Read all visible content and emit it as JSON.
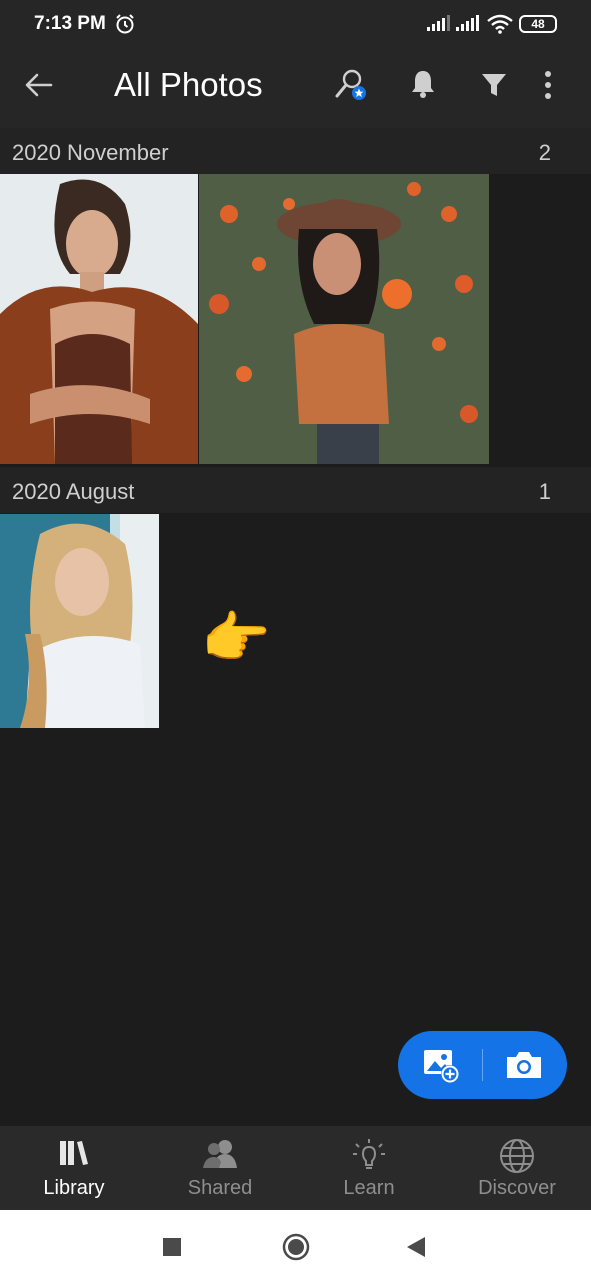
{
  "status_bar": {
    "time": "7:13 PM",
    "battery": "48"
  },
  "app_bar": {
    "title": "All Photos",
    "icons": [
      "back-arrow-icon",
      "people-search-icon",
      "bell-icon",
      "filter-icon",
      "more-vertical-icon"
    ]
  },
  "sections": [
    {
      "label": "2020 November",
      "count": "2",
      "photos": [
        "portrait-woman-rust-jacket",
        "portrait-woman-hat-flowers"
      ]
    },
    {
      "label": "2020 August",
      "count": "1",
      "photos": [
        "portrait-woman-white-shirt"
      ]
    }
  ],
  "annotation": {
    "emoji": "👉"
  },
  "fab": {
    "icons": [
      "add-photo-icon",
      "camera-icon"
    ],
    "color": "#1473e6"
  },
  "bottom_nav": {
    "items": [
      {
        "label": "Library",
        "icon": "library-icon",
        "active": true
      },
      {
        "label": "Shared",
        "icon": "shared-people-icon",
        "active": false
      },
      {
        "label": "Learn",
        "icon": "lightbulb-icon",
        "active": false
      },
      {
        "label": "Discover",
        "icon": "globe-icon",
        "active": false
      }
    ]
  },
  "system_nav": {
    "icons": [
      "recents-square-icon",
      "home-circle-icon",
      "back-triangle-icon"
    ]
  }
}
